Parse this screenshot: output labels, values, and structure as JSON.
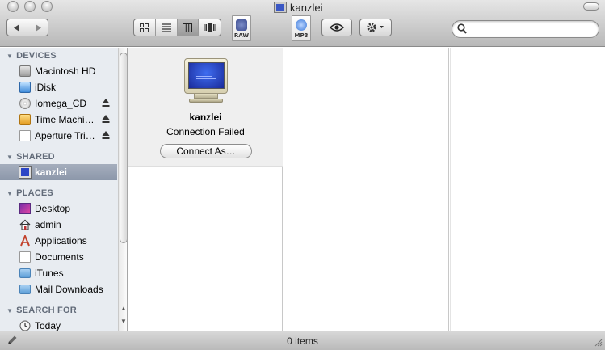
{
  "window": {
    "title": "kanzlei"
  },
  "toolbar": {
    "back_icon": "back-arrow-icon",
    "forward_icon": "forward-arrow-icon",
    "view_modes": [
      "icon-view",
      "list-view",
      "column-view",
      "coverflow-view"
    ],
    "selected_view": "column-view",
    "raw_file_tag": "RAW",
    "mp3_file_tag": "MP3",
    "quicklook_icon": "eye-icon",
    "action_icon": "gear-icon",
    "search_placeholder": ""
  },
  "sidebar": {
    "devices_header": "DEVICES",
    "devices": [
      {
        "label": "Macintosh HD",
        "icon": "hard-drive-icon",
        "eject": false
      },
      {
        "label": "iDisk",
        "icon": "idisk-icon",
        "eject": false
      },
      {
        "label": "Iomega_CD",
        "icon": "cd-icon",
        "eject": true
      },
      {
        "label": "Time Machi…",
        "icon": "time-machine-icon",
        "eject": true
      },
      {
        "label": "Aperture Tri…",
        "icon": "disk-image-icon",
        "eject": true
      }
    ],
    "shared_header": "SHARED",
    "shared": [
      {
        "label": "kanzlei",
        "icon": "monitor-icon",
        "selected": true
      }
    ],
    "places_header": "PLACES",
    "places": [
      {
        "label": "Desktop",
        "icon": "desktop-icon"
      },
      {
        "label": "admin",
        "icon": "home-icon"
      },
      {
        "label": "Applications",
        "icon": "applications-icon"
      },
      {
        "label": "Documents",
        "icon": "documents-icon"
      },
      {
        "label": "iTunes",
        "icon": "folder-icon"
      },
      {
        "label": "Mail Downloads",
        "icon": "folder-icon"
      }
    ],
    "search_header": "SEARCH FOR",
    "search_for": [
      {
        "label": "Today",
        "icon": "clock-icon"
      }
    ]
  },
  "preview": {
    "name": "kanzlei",
    "status": "Connection Failed",
    "connect_label": "Connect As…"
  },
  "statusbar": {
    "text": "0 items"
  },
  "colors": {
    "sidebar_bg": "#e8ecf1",
    "selection": "#8c97aa",
    "section_header": "#626b79"
  }
}
